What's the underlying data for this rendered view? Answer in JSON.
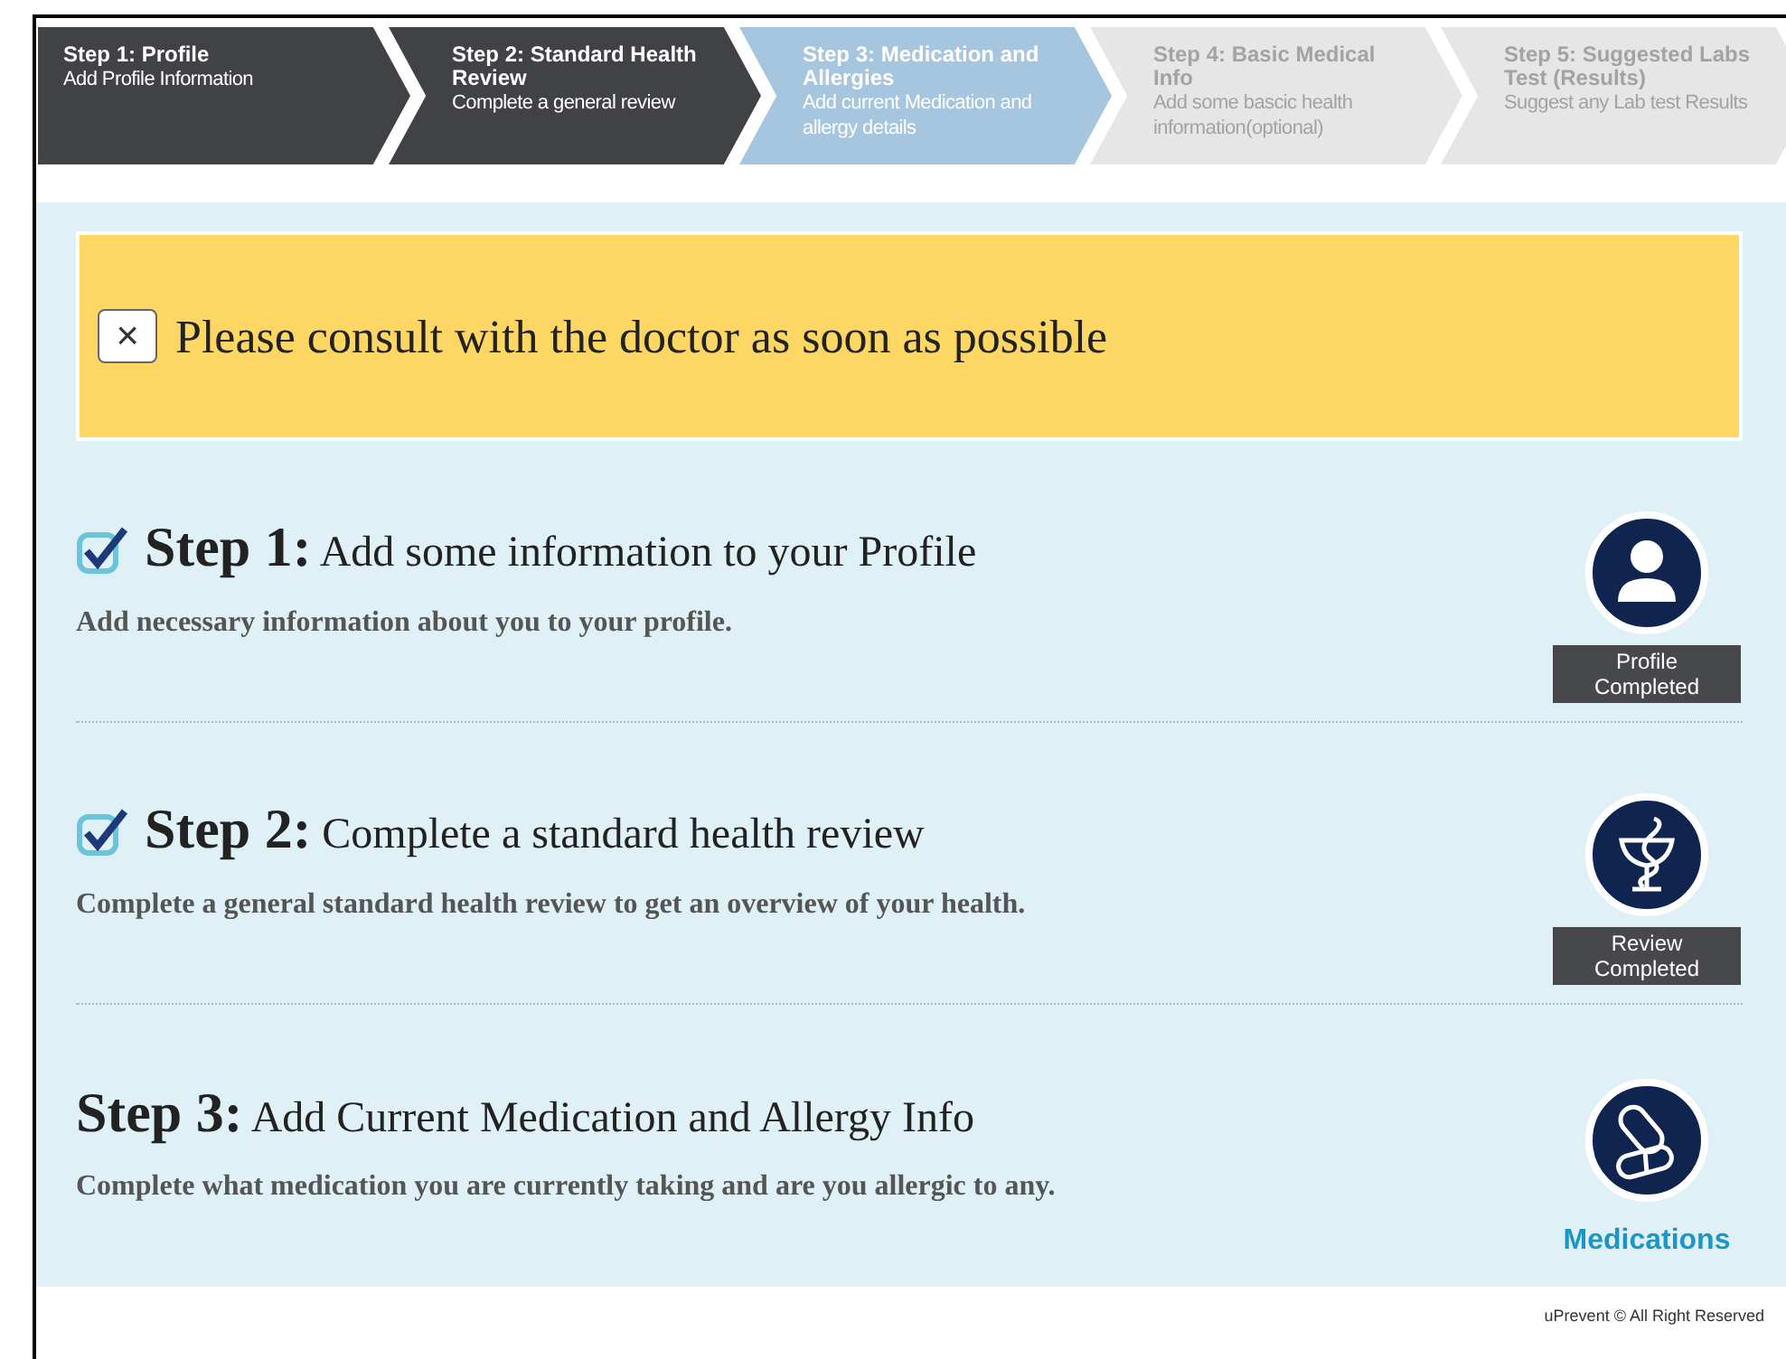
{
  "wizard_steps": [
    {
      "title": "Step 1: Profile",
      "subtitle": "Add Profile Information",
      "completed": true,
      "selected": false
    },
    {
      "title": "Step 2: Standard Health Review",
      "subtitle": "Complete a general review",
      "completed": true,
      "selected": false
    },
    {
      "title": "Step 3: Medication and Allergies",
      "subtitle": "Add current Medication and allergy details",
      "completed": false,
      "selected": true
    },
    {
      "title": "Step 4: Basic Medical Info",
      "subtitle": "Add some bascic health information(optional)",
      "completed": false,
      "selected": false
    },
    {
      "title": "Step 5: Suggested Labs Test (Results)",
      "subtitle": "Suggest any Lab test Results",
      "completed": false,
      "selected": false
    }
  ],
  "alert": {
    "close": "×",
    "message": "Please consult with the doctor as soon as possible"
  },
  "sections": [
    {
      "checked": true,
      "step_label": "Step 1:",
      "title": "Add some information to your Profile",
      "description": "Add necessary information about you to your profile.",
      "kind": "profile",
      "completed": true,
      "status_text": "Profile Completed"
    },
    {
      "checked": true,
      "step_label": "Step 2:",
      "title": "Complete a standard health review",
      "description": "Complete a general standard health review to get an overview of your health.",
      "kind": "review",
      "completed": true,
      "status_text": "Review Completed"
    },
    {
      "checked": false,
      "step_label": "Step 3:",
      "title": "Add Current Medication and Allergy Info",
      "description": "Complete what medication you are currently taking and are you allergic to any.",
      "kind": "medication",
      "completed": false,
      "status_text": "Medications"
    }
  ],
  "footer": "uPrevent © All Right Reserved"
}
